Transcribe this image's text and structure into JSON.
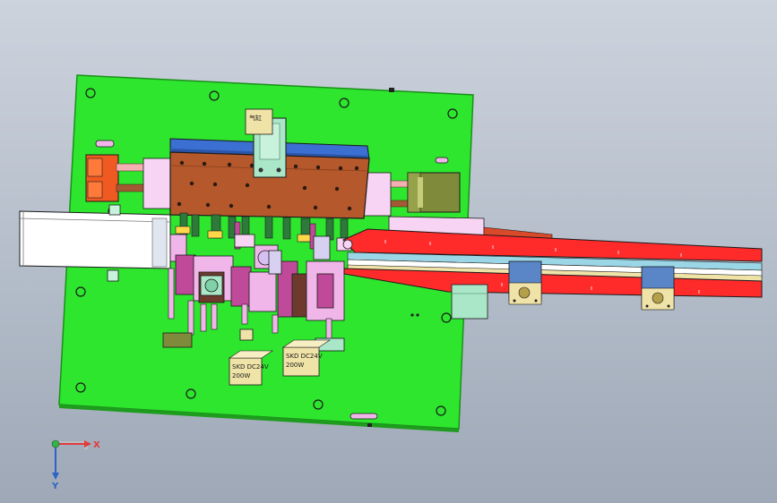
{
  "viewport": {
    "background_top": "#cdd3dd",
    "background_bottom": "#9ea8b6"
  },
  "colors": {
    "base_plate": "#2ee62e",
    "manifold_block": "#b5582c",
    "manifold_top_bar": "#3b6fd1",
    "conveyor_red": "#ff2b2b",
    "white_guard": "#ffffff",
    "pink_blocks": "#f0b6e9",
    "magenta_blocks": "#c04a9a",
    "yellow_labels": "#f0e3a8",
    "motor_mint": "#a9e7c8",
    "olive_cylinder": "#7f8a3a",
    "orange_fitting": "#f05a22"
  },
  "labels": {
    "motor_label_top": "气缸",
    "motor_label_left_1": "SKD DC24V",
    "motor_label_left_2": "200W",
    "motor_label_right_1": "SKD DC24V",
    "motor_label_right_2": "200W"
  },
  "triad": {
    "x_label": "X",
    "y_label": "Y",
    "x_color": "#e23b3b",
    "y_color": "#2d62c9",
    "z_color": "#34b34a"
  }
}
